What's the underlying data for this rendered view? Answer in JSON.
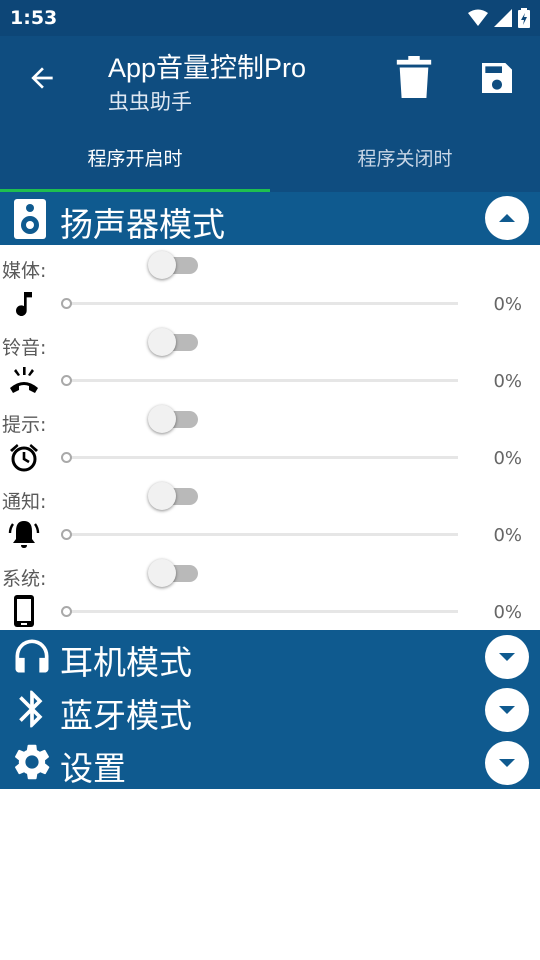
{
  "status": {
    "time": "1:53"
  },
  "appbar": {
    "title": "App音量控制Pro",
    "subtitle": "虫虫助手"
  },
  "tabs": [
    {
      "label": "程序开启时",
      "active": true
    },
    {
      "label": "程序关闭时",
      "active": false
    }
  ],
  "speaker": {
    "title": "扬声器模式",
    "rows": [
      {
        "label": "媒体:",
        "icon": "music-note-icon",
        "value": "0%",
        "level": 0
      },
      {
        "label": "铃音:",
        "icon": "phone-ring-icon",
        "value": "0%",
        "level": 0
      },
      {
        "label": "提示:",
        "icon": "alarm-clock-icon",
        "value": "0%",
        "level": 0
      },
      {
        "label": "通知:",
        "icon": "bell-icon",
        "value": "0%",
        "level": 0
      },
      {
        "label": "系统:",
        "icon": "smartphone-icon",
        "value": "0%",
        "level": 0
      }
    ]
  },
  "headphone": {
    "title": "耳机模式"
  },
  "bluetooth": {
    "title": "蓝牙模式"
  },
  "settings": {
    "title": "设置"
  },
  "colors": {
    "statusbar": "#0d4677",
    "appbar": "#0f4d80",
    "section": "#0f5a8f",
    "indicator": "#1fbf4f"
  }
}
